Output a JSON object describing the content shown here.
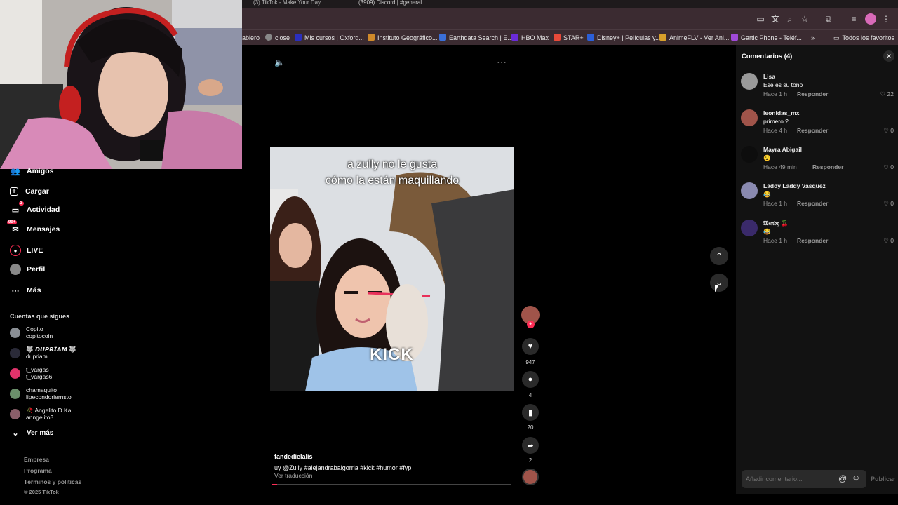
{
  "browser": {
    "tabs": [
      "(3) TikTok - Make Your Day",
      "(3909) Discord | #general"
    ],
    "bookmarks": [
      {
        "label": "ablero",
        "color": "#3b2b31"
      },
      {
        "label": "close",
        "color": "#888888"
      },
      {
        "label": "Mis cursos | Oxford...",
        "color": "#2b2fbf"
      },
      {
        "label": "Instituto Geográfico...",
        "color": "#d08a2a"
      },
      {
        "label": "Earthdata Search | E...",
        "color": "#3a6fd8"
      },
      {
        "label": "HBO Max",
        "color": "#6a2bd8"
      },
      {
        "label": "STAR+",
        "color": "#e84a3a"
      },
      {
        "label": "Disney+ | Películas y...",
        "color": "#2b5fd8"
      },
      {
        "label": "AnimeFLV - Ver Ani...",
        "color": "#d8a02b"
      },
      {
        "label": "Gartic Phone - Teléf...",
        "color": "#a04ad8"
      }
    ],
    "all_bookmarks": "Todos los favoritos",
    "more_bookmarks": "»"
  },
  "sidebar": {
    "nav": [
      {
        "label": "Amigos",
        "icon": "friends-icon"
      },
      {
        "label": "Cargar",
        "icon": "upload-icon"
      },
      {
        "label": "Actividad",
        "icon": "activity-icon",
        "badge": "3"
      },
      {
        "label": "Mensajes",
        "icon": "messages-icon",
        "badge": "99+"
      },
      {
        "label": "LIVE",
        "icon": "live-icon"
      },
      {
        "label": "Perfil",
        "icon": "profile-icon"
      },
      {
        "label": "Más",
        "icon": "more-icon"
      }
    ],
    "following_title": "Cuentas que sigues",
    "following": [
      {
        "name": "Copito",
        "handle": "copitocoin",
        "color": "#8a8f95"
      },
      {
        "name": "🐺 𝘿𝙐𝙋𝙍𝙄𝘼𝙈 🐺",
        "handle": "dupriam",
        "color": "#2a2a38"
      },
      {
        "name": "t_vargas",
        "handle": "t_vargas6",
        "color": "#e0336b"
      },
      {
        "name": "chamaquito",
        "handle": "lipecondoriernsto",
        "color": "#6a8f6a"
      },
      {
        "name": "🥀 Angelito D Ka...",
        "handle": "anngelito3",
        "color": "#8a5f6a"
      }
    ],
    "see_more": "Ver más",
    "footer": [
      "Empresa",
      "Programa",
      "Términos y políticas",
      "© 2025 TikTok"
    ]
  },
  "video": {
    "caption_line1": "a zully no le gusta",
    "caption_line2": "cómo la están maquillando",
    "watermark": "KICK",
    "author": "fandedielalis",
    "description": "uy @Zully  #alejandrabaigorria  #kick  #humor  #fyp",
    "translate": "Ver traducción",
    "likes": "947",
    "comments": "4",
    "saves": "20",
    "shares": "2"
  },
  "comments_panel": {
    "title": "Comentarios (4)",
    "input_placeholder": "Añadir comentario...",
    "publish": "Publicar",
    "reply_label": "Responder",
    "items": [
      {
        "user": "Lisa",
        "text": "Ese es su tono",
        "time": "Hace 1 h",
        "likes": "22",
        "color": "#9a9a9a"
      },
      {
        "user": "leonidas_mx",
        "text": "primero ?",
        "time": "Hace 4 h",
        "likes": "0",
        "color": "#a0544a"
      },
      {
        "user": "Mayra Abigail",
        "text": "😮",
        "time": "Hace 49 min",
        "likes": "0",
        "color": "#0d0d0d"
      },
      {
        "user": "Laddy Laddy Vasquez",
        "text": "😂",
        "time": "Hace 1 h",
        "likes": "0",
        "color": "#8a8ab0"
      },
      {
        "user": "𝔚𝔢𝔫𝔡𝔶 🍒",
        "text": "😂",
        "time": "Hace 1 h",
        "likes": "0",
        "color": "#3a2a6a"
      }
    ]
  }
}
